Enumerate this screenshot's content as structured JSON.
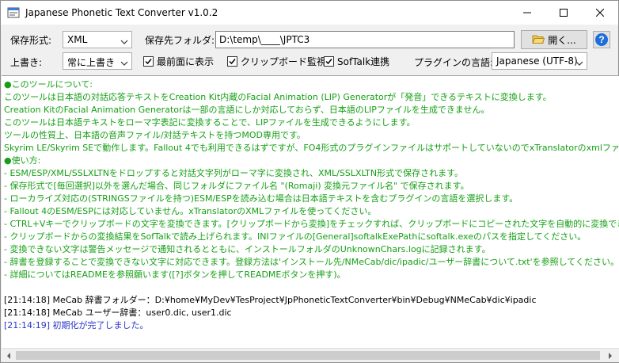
{
  "window": {
    "title": "Japanese Phonetic Text Converter v1.0.2"
  },
  "toolbar": {
    "save_format_label": "保存形式:",
    "save_format_value": "XML",
    "save_folder_label": "保存先フォルダ:",
    "save_folder_value": "D:\\temp\\____\\JPTC3",
    "open_button_label": "開く...",
    "overwrite_label": "上書き:",
    "overwrite_value": "常に上書き",
    "always_on_top_label": "最前面に表示",
    "clipboard_monitor_label": "クリップボード監視",
    "softalk_label": "SofTalk連携",
    "plugin_language_label": "プラグインの言語:",
    "plugin_language_value": "Japanese (UTF-8)"
  },
  "log": {
    "lines": [
      "●このツールについて:",
      "このツールは日本語の対話応答テキストをCreation Kit内蔵のFacial Animation (LIP) Generatorが「発音」できるテキストに変換します。",
      "Creation KitのFacial Animation Generatorは一部の言語にしか対応しておらず、日本語のLIPファイルを生成できません。",
      "このツールは日本語テキストをローマ字表記に変換することで、LIPファイルを生成できるようにします。",
      "ツールの性質上、日本語の音声ファイル/対話テキストを持つMOD専用です。",
      "Skyrim LE/Skyrim SEで動作します。Fallout 4でも利用できるはずですが、FO4形式のプラグインファイルはサポートしていないのでxTranslatorのxmlファイル",
      "●使い方:",
      "- ESM/ESP/XML/SSLXLTNをドロップすると対話文字列がローマ字に変換され、XML/SSLXLTN形式で保存されます。",
      "- 保存形式で[毎回選択]以外を選んだ場合、同じフォルダにファイル名 \"(Romaji) 変換元ファイル名\" で保存されます。",
      "- ローカライズ対応の(STRINGSファイルを持つ)ESM/ESPを読み込む場合は日本語テキストを含むプラグインの言語を選択します。",
      "- Fallout 4のESM/ESPには対応していません。xTranslatorのXMLファイルを使ってください。",
      "- CTRL+Vキーでクリップボードの文字を変換できます。[クリップボードから変換]をチェックすれば、クリップボードにコピーされた文字を自動的に変換できます",
      "- クリップボードからの変換結果をSofTalkで読み上げられます。INIファイルの[General]softalkExePathにsoftalk.exeのパスを指定してください。",
      "- 変換できない文字は警告メッセージで通知されるとともに、インストールフォルダのUnknownChars.logに記録されます。",
      "- 辞書を登録することで変換できない文字に対応できます。登録方法は'インストール先/NMeCab/dic/ipadic/ユーザー辞書について.txt'を参照してください。",
      "- 詳細についてはREADMEを参照願います([?]ボタンを押してREADMEボタンを押す)。",
      "",
      "[21:14:18] MeCab 辞書フォルダー：D:¥home¥MyDev¥TesProject¥JpPhoneticTextConverter¥bin¥Debug¥NMeCab¥dic¥ipadic",
      "[21:14:18] MeCab ユーザー辞書：user0.dic, user1.dic",
      "[21:14:19] 初期化が完了しました。"
    ]
  },
  "colors": {
    "info_text": "#15a015",
    "status_text": "#000000",
    "done_text": "#2a36c8",
    "help_accent": "#1e6fd9"
  },
  "icons": {
    "app": "app-icon",
    "open_folder": "folder-open-icon",
    "help": "help-icon",
    "minimize": "minimize-icon",
    "maximize": "maximize-icon",
    "close": "close-icon"
  }
}
